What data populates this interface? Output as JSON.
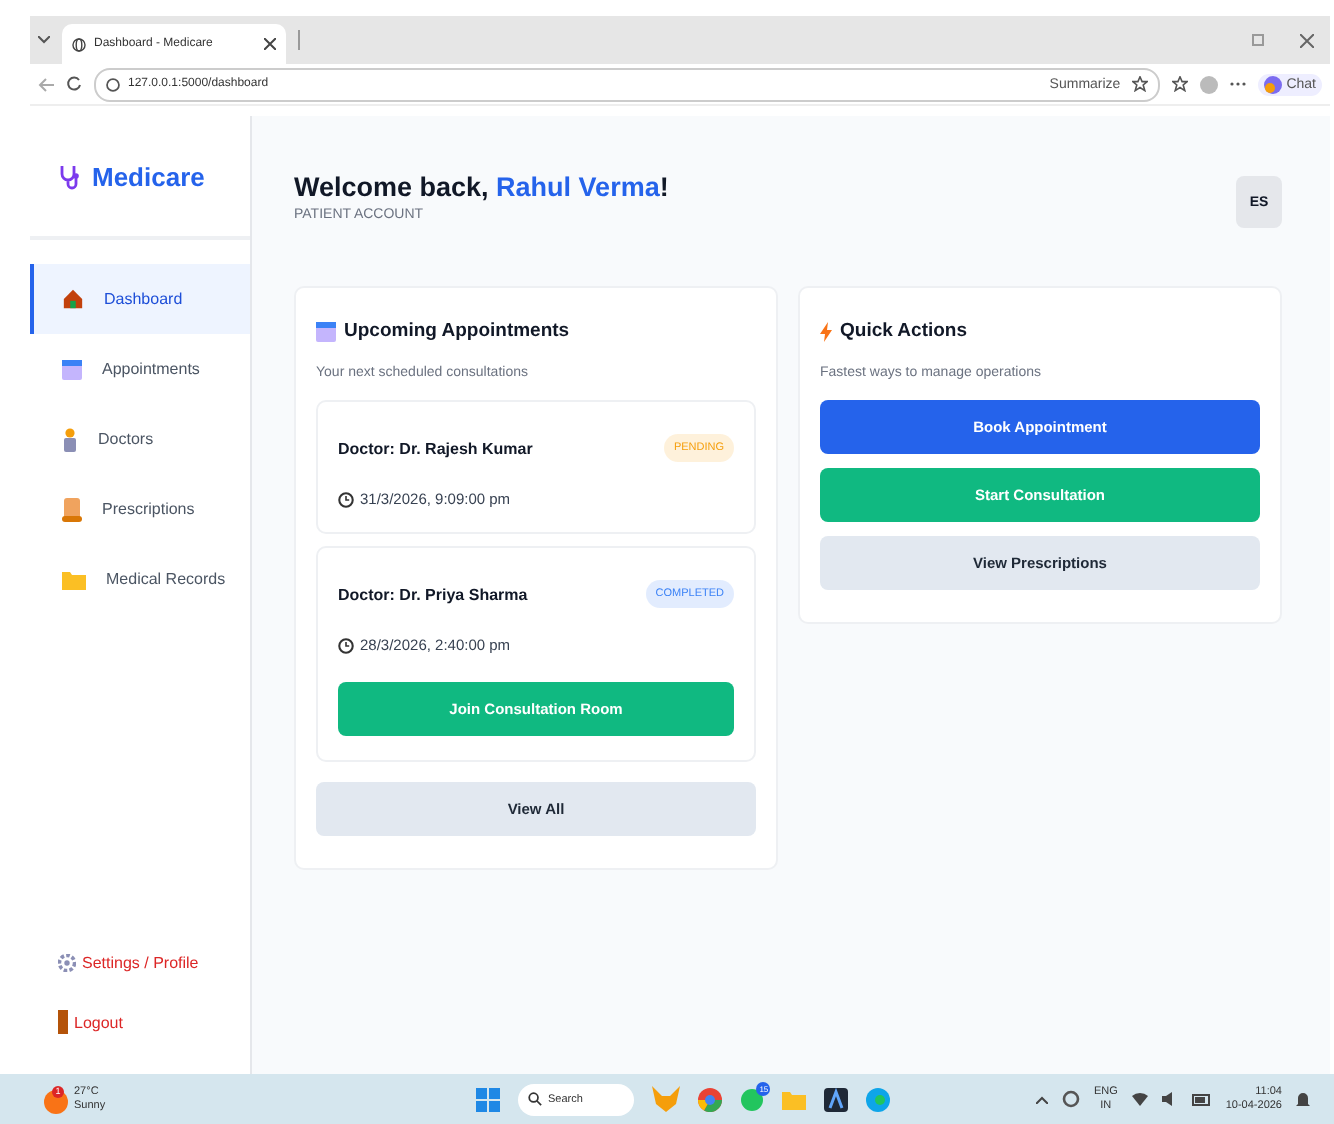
{
  "browser": {
    "tab_title": "Dashboard - Medicare",
    "url": "127.0.0.1:5000/dashboard",
    "summarize": "Summarize",
    "chat": "Chat"
  },
  "sidebar": {
    "brand": "Medicare",
    "items": [
      {
        "label": "Dashboard",
        "selected": true
      },
      {
        "label": "Appointments",
        "selected": false
      },
      {
        "label": "Doctors",
        "selected": false
      },
      {
        "label": "Prescriptions",
        "selected": false
      },
      {
        "label": "Medical Records",
        "selected": false
      }
    ],
    "footer": [
      "Settings / Profile",
      "Logout"
    ]
  },
  "header": {
    "greeting": "Welcome back,",
    "user_name": "Rahul Verma",
    "suffix": "!",
    "role": "PATIENT ACCOUNT",
    "avatar": "ES"
  },
  "appointments": {
    "title": "Upcoming Appointments",
    "subtitle": "Your next scheduled consultations",
    "items": [
      {
        "doctor": "Doctor: Dr. Rajesh Kumar",
        "status": "PENDING",
        "color": "#f59e0b",
        "time": "31/3/2026, 9:09:00 pm"
      },
      {
        "doctor": "Doctor: Dr. Priya Sharma",
        "status": "COMPLETED",
        "color": "#3b82f6",
        "time": "28/3/2026, 2:40:00 pm",
        "action": "Join Consultation Room"
      }
    ],
    "view_all": "View All"
  },
  "quick_actions": {
    "title": "Quick Actions",
    "subtitle": "Fastest ways to manage operations",
    "buttons": [
      {
        "label": "Book Appointment",
        "kind": "primary"
      },
      {
        "label": "Start Consultation",
        "kind": "success"
      },
      {
        "label": "View Prescriptions",
        "kind": "secondary"
      }
    ]
  },
  "taskbar": {
    "temperature": "27°C",
    "weather": "Sunny",
    "weather_badge": "1",
    "search": "Search",
    "chat_badge": "15",
    "language": "ENG",
    "region": "IN",
    "time": "11:04",
    "date": "10-04-2026"
  }
}
